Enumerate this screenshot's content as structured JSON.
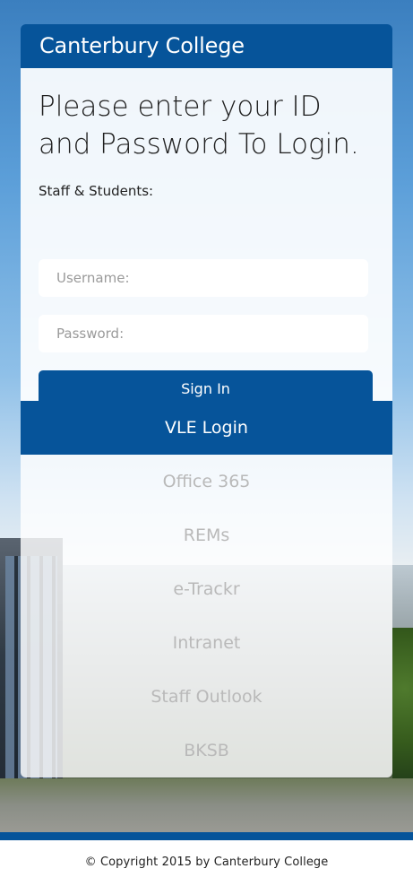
{
  "college": {
    "name": "Canterbury College"
  },
  "login": {
    "title": "Please enter your ID and Password To Login.",
    "subtitle": "Staff & Students:",
    "username_placeholder": "Username:",
    "password_placeholder": "Password:",
    "signin_label": "Sign In"
  },
  "links": {
    "header": "VLE Login",
    "items": [
      {
        "label": "Office 365"
      },
      {
        "label": "REMs"
      },
      {
        "label": "e-Trackr"
      },
      {
        "label": "Intranet"
      },
      {
        "label": "Staff Outlook"
      },
      {
        "label": "BKSB"
      }
    ]
  },
  "footer": {
    "copyright": "© Copyright 2015 by Canterbury College"
  },
  "colors": {
    "brand": "#06549a",
    "link_text": "#b9b9b9"
  }
}
